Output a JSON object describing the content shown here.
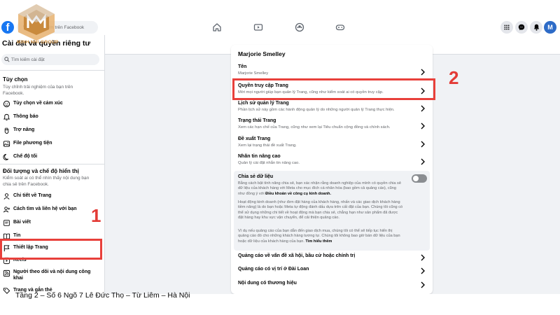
{
  "topbar": {
    "search_placeholder": "Tìm kiếm trên Facebook",
    "avatar_initial": "M",
    "brand_name": "MINH NHI GROUP"
  },
  "sidebar": {
    "title": "Cài đặt và quyền riêng tư",
    "search_placeholder": "Tìm kiếm cài đặt",
    "section1": {
      "title": "Tùy chọn",
      "desc": "Tùy chỉnh trải nghiệm của bạn trên Facebook.",
      "items": [
        {
          "label": "Tùy chọn về cảm xúc",
          "icon": "smiley-icon"
        },
        {
          "label": "Thông báo",
          "icon": "bell-icon"
        },
        {
          "label": "Trợ năng",
          "icon": "hand-icon"
        },
        {
          "label": "File phương tiện",
          "icon": "media-icon"
        },
        {
          "label": "Chế độ tối",
          "icon": "moon-icon"
        }
      ]
    },
    "section2": {
      "title": "Đối tượng và chế độ hiển thị",
      "desc": "Kiểm soát ai có thể nhìn thấy nội dung bạn chia sẻ trên Facebook.",
      "items": [
        {
          "label": "Chi tiết về Trang",
          "icon": "page-details-icon"
        },
        {
          "label": "Cách tìm và liên hệ với bạn",
          "icon": "person-add-icon"
        },
        {
          "label": "Bài viết",
          "icon": "post-icon"
        },
        {
          "label": "Tin",
          "icon": "book-icon"
        },
        {
          "label": "Thiết lập Trang",
          "icon": "flag-icon"
        },
        {
          "label": "Reels",
          "icon": "reels-icon"
        },
        {
          "label": "Người theo dõi và nội dung công khai",
          "icon": "rss-icon"
        },
        {
          "label": "Trang và gắn thẻ",
          "icon": "tag-icon"
        }
      ]
    }
  },
  "main": {
    "card_title": "Marjorie Smelley",
    "rows": [
      {
        "title": "Tên",
        "sub": "Marjorie Smelley"
      },
      {
        "title": "Quyền truy cập Trang",
        "sub": "Mời mọi người giúp bạn quản lý Trang, cũng như kiểm soát ai có quyền truy cập."
      },
      {
        "title": "Lịch sử quản lý Trang",
        "sub": "Phần lịch sử này gồm các hành động quản lý do những người quản lý Trang thực hiện."
      },
      {
        "title": "Trạng thái Trang",
        "sub": "Xem các hạn chế của Trang, cũng như xem lại Tiêu chuẩn cộng đồng và chính sách."
      },
      {
        "title": "Đề xuất Trang",
        "sub": "Xem lại trạng thái đề xuất Trang."
      },
      {
        "title": "Nhãn tin nâng cao",
        "sub": "Quản lý cài đặt nhắn tin nâng cao."
      }
    ],
    "data_sharing": {
      "title": "Chia sẻ dữ liệu",
      "p1_pre": "Bằng cách bật tính năng chia sẻ, bạn xác nhận rằng doanh nghiệp của mình có quyền chia sẻ dữ liệu của khách hàng với Meta cho mục đích cá nhân hóa (bao gồm cả quảng cáo), cũng như đồng ý với ",
      "p1_bold": "Điều khoản về công cụ kinh doanh.",
      "p2": "Hoạt động kinh doanh (như đơn đặt hàng của khách hàng, nhấn và các giao dịch khách hàng tiềm năng) là do bạn hoặc Meta tự động đánh dấu dựa trên cất đặt của bạn. Chúng tôi cũng có thể sử dụng những chi tiết về hoạt động mà bạn chia sẻ, chẳng hạn như sản phẩm đã được đặt hàng hay khu vực vận chuyển, để cải thiện quảng cáo.",
      "p3_pre": "Vì dụ nếu quảng cáo của bạn dẫn đến giao dịch mua, chúng tôi có thể sẽ tiếp tục hiển thị quảng cáo đó cho những khách hàng tương tự. Chúng tôi không bao giờ bán dữ liệu của bạn hoặc dữ liệu của khách hàng của bạn. ",
      "p3_link": "Tìm hiểu thêm",
      "toggle_on": false
    },
    "bottom_rows": [
      {
        "title": "Quảng cáo về vấn đề xã hội, bầu cử hoặc chính trị"
      },
      {
        "title": "Quảng cáo có vị trí ở Đài Loan"
      },
      {
        "title": "Nội dung có thương hiệu"
      }
    ]
  },
  "annotations": {
    "callout1": "1",
    "callout2": "2",
    "color": "#e8403b"
  },
  "footer": {
    "address": "Tầng 2 – Số 6 Ngõ 7 Lê Đức Thọ – Từ Liêm – Hà Nội"
  }
}
